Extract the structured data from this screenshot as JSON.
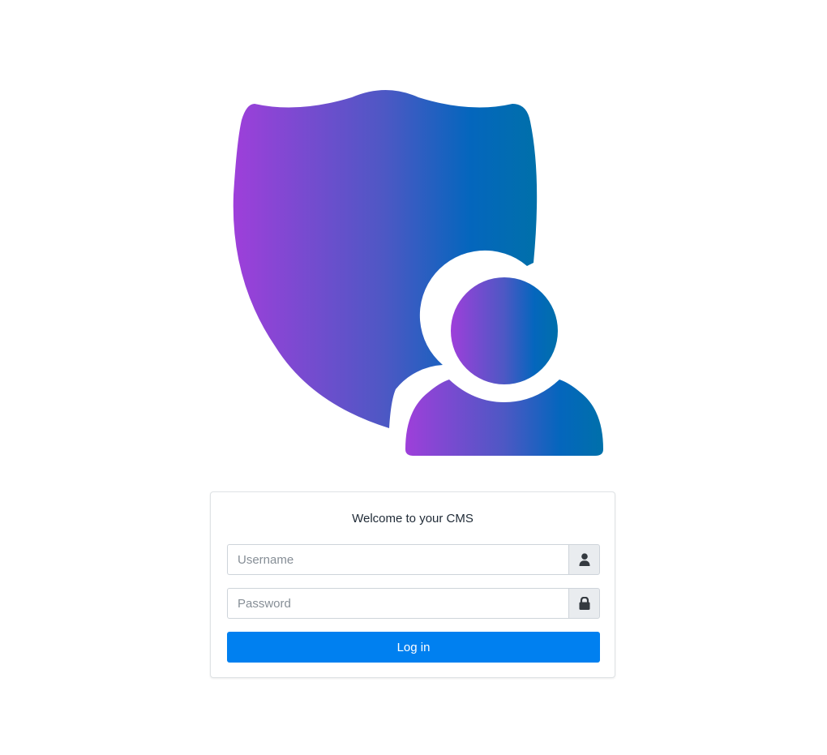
{
  "logo": {
    "icon": "user-shield-icon",
    "gradient_start": "#9b40d8",
    "gradient_mid": "#4a5bc4",
    "gradient_end": "#0068b8"
  },
  "login_card": {
    "title": "Welcome to your CMS",
    "username": {
      "placeholder": "Username",
      "value": "",
      "icon": "user-icon"
    },
    "password": {
      "placeholder": "Password",
      "value": "",
      "icon": "lock-icon"
    },
    "submit_label": "Log in",
    "accent_color": "#0080f0"
  }
}
